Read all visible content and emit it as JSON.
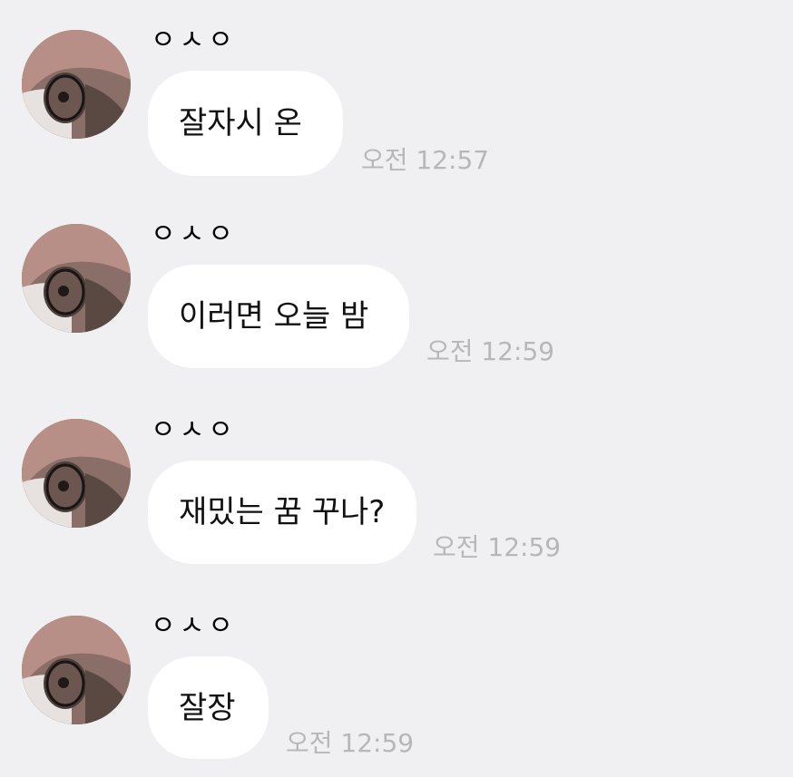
{
  "messages": [
    {
      "sender": "ㅇㅅㅇ",
      "text": "잘자시 온",
      "time": "오전 12:57"
    },
    {
      "sender": "ㅇㅅㅇ",
      "text": "이러면 오늘 밤",
      "time": "오전 12:59"
    },
    {
      "sender": "ㅇㅅㅇ",
      "text": "재밌는 꿈 꾸나?",
      "time": "오전 12:59"
    },
    {
      "sender": "ㅇㅅㅇ",
      "text": "잘장",
      "time": "오전 12:59"
    }
  ],
  "colors": {
    "background": "#f0eff1",
    "bubble": "#ffffff",
    "timestamp": "#b7b7ba"
  },
  "icons": {
    "avatar": "profile-avatar-image"
  }
}
